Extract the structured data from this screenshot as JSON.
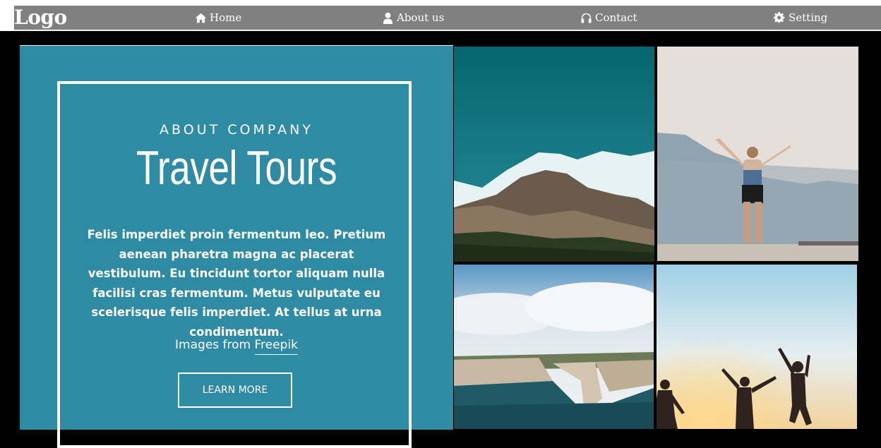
{
  "header": {
    "logo": "Logo",
    "nav": [
      {
        "label": "Home",
        "icon": "home-icon"
      },
      {
        "label": "About us",
        "icon": "user-icon"
      },
      {
        "label": "Contact",
        "icon": "headphones-icon"
      },
      {
        "label": "Setting",
        "icon": "gear-icon"
      }
    ]
  },
  "hero": {
    "overline": "ABOUT COMPANY",
    "title": "Travel Tours",
    "body": "Felis imperdiet proin fermentum leo. Pretium aenean pharetra magna ac placerat vestibulum. Eu tincidunt tortor aliquam nulla facilisi cras fermentum. Metus vulputate eu scelerisque felis imperdiet. At tellus at urna condimentum.",
    "credit_prefix": "Images from",
    "credit_link": "Freepik",
    "cta": "LEARN MORE"
  },
  "colors": {
    "nav_bg": "#808080",
    "hero_bg": "#2f8aa3",
    "page_bg": "#000000"
  }
}
